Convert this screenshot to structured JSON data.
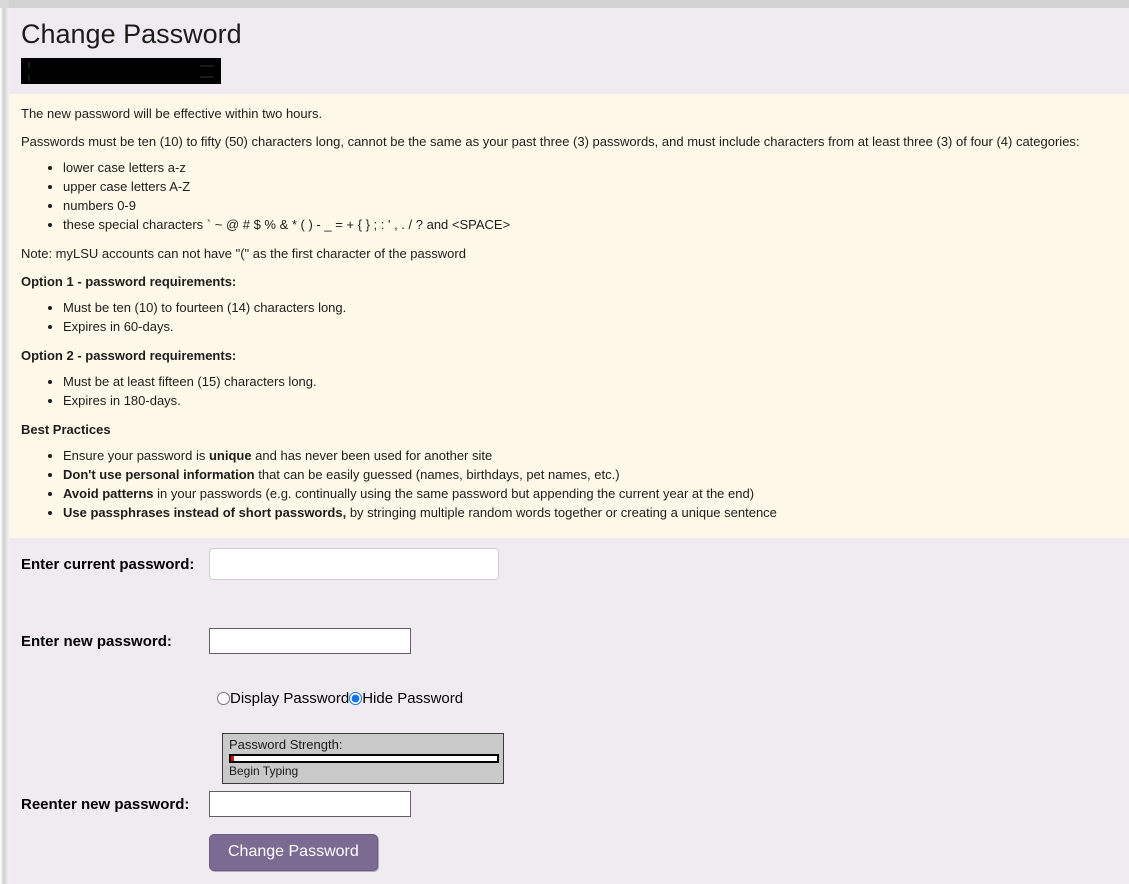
{
  "page": {
    "title": "Change Password",
    "redacted_field": ""
  },
  "instructions": {
    "effective_notice": "The new password will be effective within two hours.",
    "requirements_intro": "Passwords must be ten (10) to fifty (50) characters long, cannot be the same as your past three (3) passwords, and must include characters from at least three (3) of four (4) categories:",
    "categories": [
      "lower case letters a-z",
      "upper case letters A-Z",
      "numbers 0-9",
      "these special characters ` ~ @ # $ % & * ( ) - _ = + { } ; : ' , . / ? and <SPACE>"
    ],
    "mylsu_note": "Note: myLSU accounts can not have \"(\" as the first character of the password",
    "option1": {
      "heading_strong": "Option 1",
      "heading_rest": " - password requirements:",
      "items": [
        "Must be ten (10) to fourteen (14) characters long.",
        "Expires in 60-days."
      ]
    },
    "option2": {
      "heading_strong": "Option 2",
      "heading_rest": " - password requirements:",
      "items": [
        "Must be at least fifteen (15) characters long.",
        "Expires in 180-days."
      ]
    },
    "best_practices": {
      "heading": "Best Practices",
      "items": [
        {
          "lead": "Ensure your password is ",
          "bold": "unique",
          "tail": " and has never been used for another site"
        },
        {
          "lead": "",
          "bold": "Don't use personal information",
          "tail": " that can be easily guessed (names, birthdays, pet names, etc.)"
        },
        {
          "lead": "",
          "bold": "Avoid patterns",
          "tail": " in your passwords (e.g. continually using the same password but appending the current year at the end)"
        },
        {
          "lead": "",
          "bold": "Use passphrases instead of short passwords,",
          "tail": " by stringing multiple random words together or creating a unique sentence"
        }
      ]
    }
  },
  "form": {
    "current_password": {
      "label": "Enter current password:",
      "value": "",
      "placeholder": ""
    },
    "new_password": {
      "label": "Enter new password:",
      "value": "",
      "placeholder": ""
    },
    "reenter_password": {
      "label": "Reenter new password:",
      "value": "",
      "placeholder": ""
    },
    "visibility": {
      "display_label": "Display Password",
      "hide_label": "Hide Password",
      "selected": "hide"
    },
    "strength": {
      "label": "Password Strength:",
      "status": "Begin Typing",
      "percent": 0
    },
    "submit_label": "Change Password"
  },
  "colors": {
    "header_background": "#f0ebf1",
    "instructions_background": "#fdf8e7",
    "submit_button": "#7b6a92",
    "radio_accent": "#1273e6",
    "strength_widget_background": "#c9c9c9",
    "strength_indicator": "#d01414"
  }
}
